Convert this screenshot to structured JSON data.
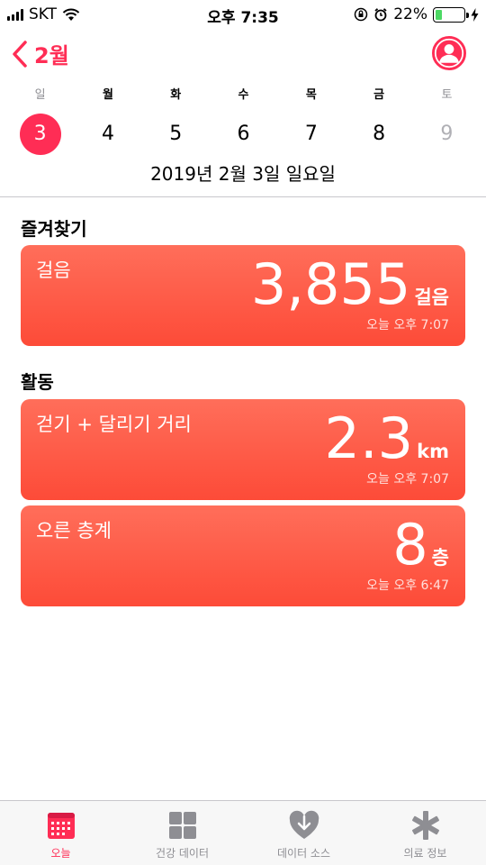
{
  "status": {
    "carrier": "SKT",
    "time": "오후 7:35",
    "battery_percent": "22%",
    "battery_level": 0.22
  },
  "nav": {
    "back_label": "2월"
  },
  "week": {
    "days": [
      "일",
      "월",
      "화",
      "수",
      "목",
      "금",
      "토"
    ],
    "dates": [
      "3",
      "4",
      "5",
      "6",
      "7",
      "8",
      "9"
    ],
    "selected_index": 0,
    "full_date": "2019년 2월 3일 일요일"
  },
  "favorites": {
    "title": "즐겨찾기",
    "cards": [
      {
        "label": "걸음",
        "value": "3,855",
        "unit": "걸음",
        "time": "오늘 오후 7:07"
      }
    ]
  },
  "activity": {
    "title": "활동",
    "cards": [
      {
        "label": "걷기 + 달리기 거리",
        "value": "2.3",
        "unit": "km",
        "time": "오늘 오후 7:07"
      },
      {
        "label": "오른 층계",
        "value": "8",
        "unit": "층",
        "time": "오늘 오후 6:47"
      }
    ]
  },
  "tabs": [
    {
      "label": "오늘",
      "icon": "today-icon",
      "active": true
    },
    {
      "label": "건강 데이터",
      "icon": "health-data-icon",
      "active": false
    },
    {
      "label": "데이터 소스",
      "icon": "data-source-icon",
      "active": false
    },
    {
      "label": "의료 정보",
      "icon": "medical-id-icon",
      "active": false
    }
  ],
  "colors": {
    "accent": "#ff2d55",
    "card": "#fd5642"
  }
}
